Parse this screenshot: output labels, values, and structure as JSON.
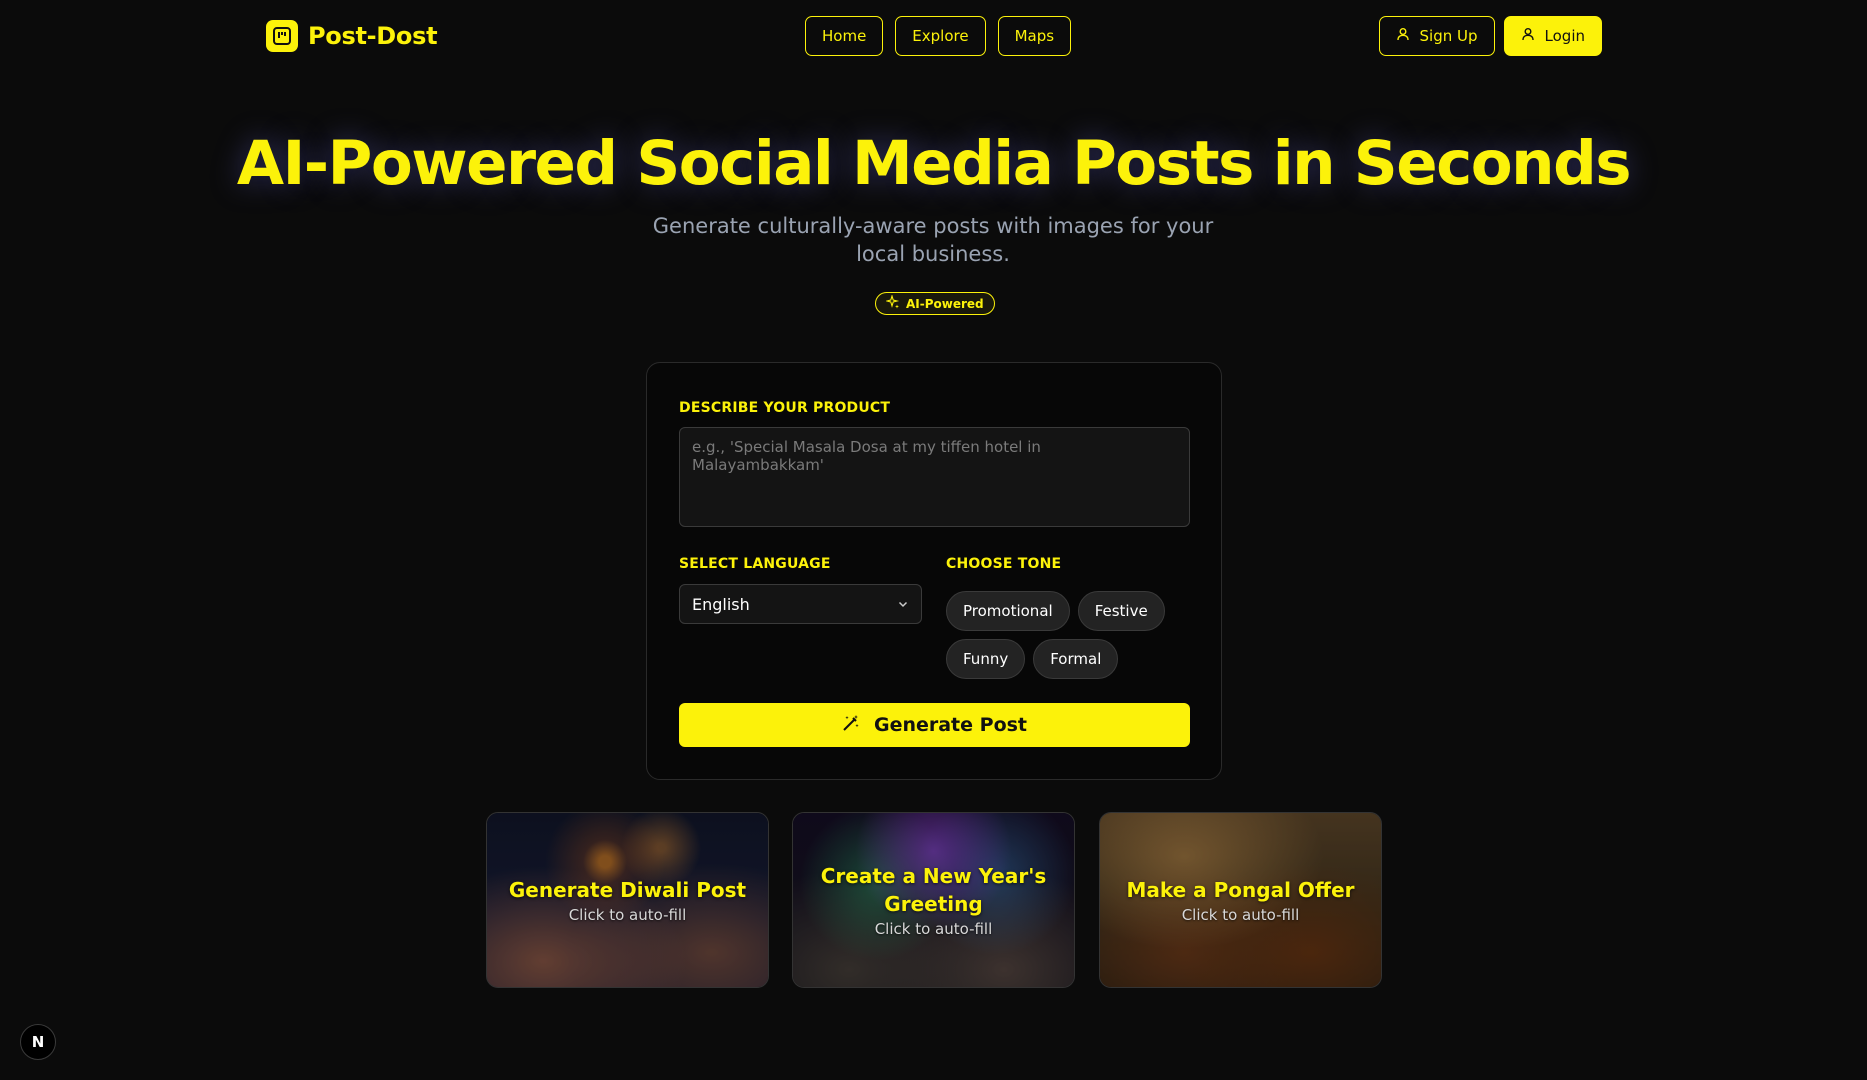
{
  "brand": {
    "name": "Post-Dost",
    "icon": "kanban-board-icon"
  },
  "nav": {
    "items": [
      "Home",
      "Explore",
      "Maps"
    ]
  },
  "auth": {
    "signup": "Sign Up",
    "login": "Login"
  },
  "hero": {
    "title": "AI-Powered Social Media Posts in Seconds",
    "subtitle": "Generate culturally-aware posts with images for your local business.",
    "badge": "AI-Powered"
  },
  "form": {
    "product_label": "DESCRIBE YOUR PRODUCT",
    "product_placeholder": "e.g., 'Special Masala Dosa at my tiffen hotel in Malayambakkam'",
    "product_value": "",
    "language_label": "SELECT LANGUAGE",
    "language_value": "English",
    "tone_label": "CHOOSE TONE",
    "tones": [
      "Promotional",
      "Festive",
      "Funny",
      "Formal"
    ],
    "generate_label": "Generate Post"
  },
  "suggestions": [
    {
      "title": "Generate Diwali Post",
      "subtitle": "Click to auto-fill"
    },
    {
      "title": "Create a New Year's Greeting",
      "subtitle": "Click to auto-fill"
    },
    {
      "title": "Make a Pongal Offer",
      "subtitle": "Click to auto-fill"
    }
  ],
  "dev_badge": "N",
  "colors": {
    "accent": "#fcf20a",
    "background": "#0b0b0b",
    "muted_text": "#9aa3b2"
  }
}
